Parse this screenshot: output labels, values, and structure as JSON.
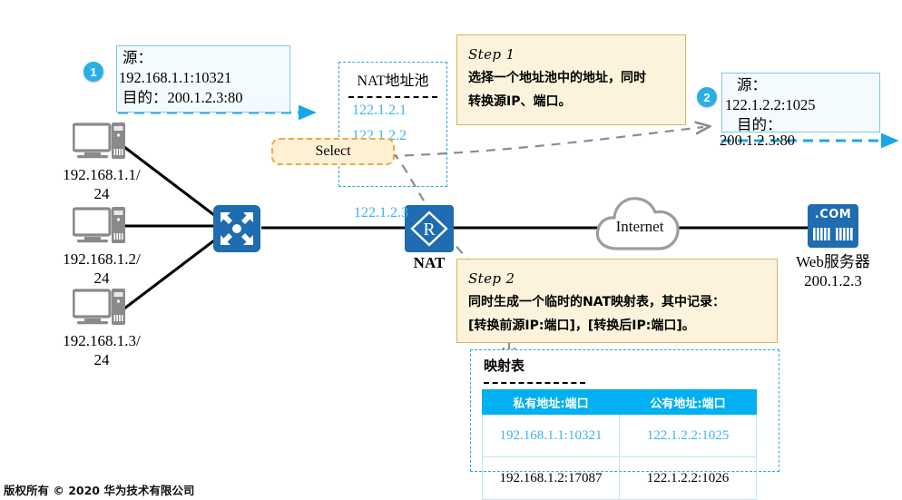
{
  "packet_before": {
    "badge": "1",
    "line1": "源：",
    "line2": "192.168.1.1:10321",
    "line3": "目的：200.1.2.3:80"
  },
  "packet_after": {
    "badge": "2",
    "line1": "源：",
    "line2": "122.1.2.2:1025",
    "line3": "目的：",
    "line4": "200.1.2.3:80"
  },
  "pool": {
    "title": "NAT地址池",
    "ips": [
      "122.1.2.1",
      "122.1.2.2"
    ],
    "free_ip": "122.1.2.3"
  },
  "select_chip": {
    "label": "Select"
  },
  "step1": {
    "step": "Step 1",
    "line1": "选择一个地址池中的地址，同时",
    "line2": "转换源IP、端口。"
  },
  "step2": {
    "step": "Step 2",
    "line1": "同时生成一个临时的NAT映射表，其中记录：",
    "line2": "[转换前源IP:端口]，[转换后IP:端口]。"
  },
  "mapping_table": {
    "title": "映射表",
    "headers": [
      "私有地址:端口",
      "公有地址:端口"
    ],
    "rows": [
      [
        "192.168.1.1:10321",
        "122.1.2.2:1025"
      ],
      [
        "192.168.1.2:17087",
        "122.1.2.2:1026"
      ]
    ]
  },
  "hosts": [
    {
      "label_line1": "192.168.1.1/",
      "label_line2": "24"
    },
    {
      "label_line1": "192.168.1.2/",
      "label_line2": "24"
    },
    {
      "label_line1": "192.168.1.3/",
      "label_line2": "24"
    }
  ],
  "nat_device": {
    "label": "NAT",
    "glyph": "R"
  },
  "cloud": {
    "label": "Internet"
  },
  "web_server": {
    "icon_text": ".COM",
    "label_line1": "Web服务器",
    "label_line2": "200.1.2.3"
  },
  "footer": {
    "text": "版权所有 © 2020 华为技术有限公司"
  },
  "colors": {
    "accent_blue": "#29a7e0",
    "light_blue_text": "#3db3ef",
    "table_header": "#00b0f0",
    "note_bg": "#fdf3dc",
    "note_border": "#d9b26a",
    "chip_border": "#f0a93c",
    "device_blue": "#1f6cb0",
    "gray_dash": "#8c8c8c"
  }
}
